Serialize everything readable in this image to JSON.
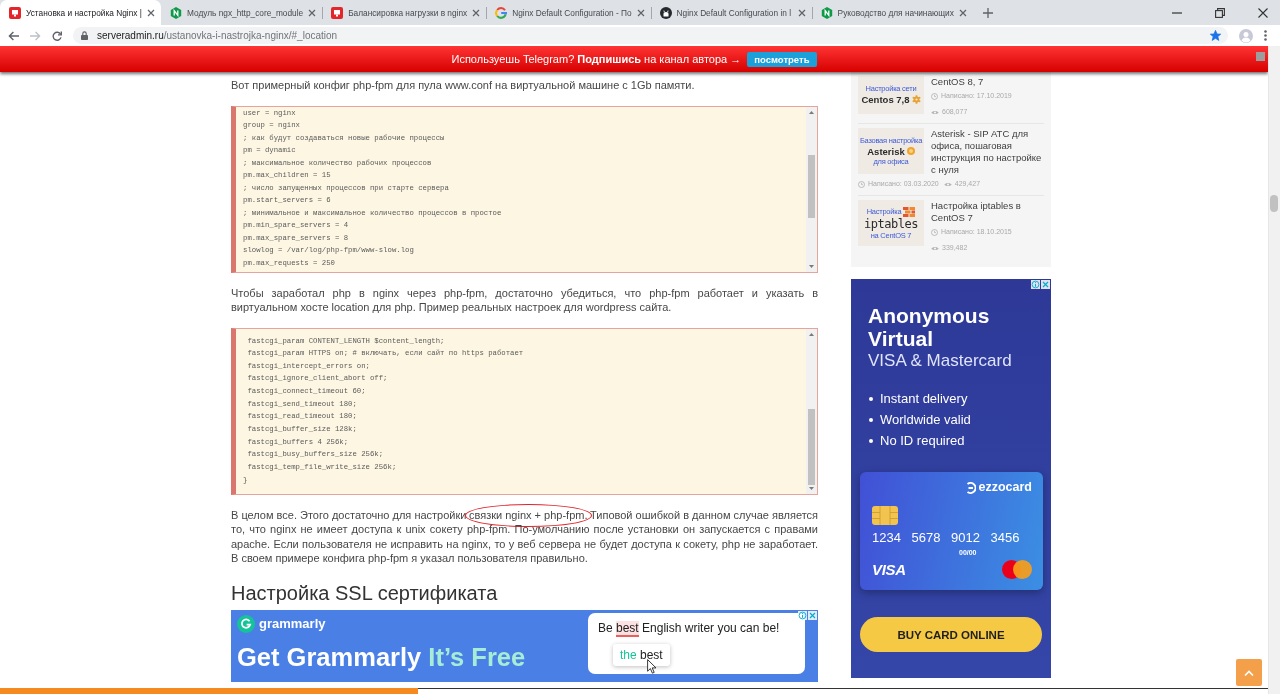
{
  "browser": {
    "tabs": [
      {
        "title": "Установка и настройка Nginx |",
        "kind": "square",
        "selected": true
      },
      {
        "title": "Модуль ngx_http_core_module",
        "kind": "hexagon",
        "selected": false
      },
      {
        "title": "Балансировка нагрузки в nginx",
        "kind": "square",
        "selected": false
      },
      {
        "title": "Nginx Default Configuration - По",
        "kind": "ring",
        "selected": false
      },
      {
        "title": "Nginx Default Configuration in l",
        "kind": "disc",
        "selected": false
      },
      {
        "title": "Руководство для начинающих",
        "kind": "hexagon",
        "selected": false
      }
    ],
    "back_disabled": false,
    "forward_disabled": true,
    "address": {
      "host": "serveradmin.ru",
      "path": "/ustanovka-i-nastrojka-nginx/#_location",
      "bookmarked": true
    }
  },
  "banner": {
    "text": "Используешь Telegram? **Подпишись** на канал автора →",
    "button": "посмотреть"
  },
  "article": {
    "blocks": [
      {
        "kind": "paragraph",
        "text": "Вот примерный конфиг php-fpm для пула www.conf на виртуальной машине с 1Gb памяти."
      },
      {
        "kind": "code",
        "lines": [
          "user = nginx",
          "group = nginx",
          "; как будут создаваться новые рабочие процессы",
          "pm = dynamic",
          "; максимальное количество рабочих процессов",
          "pm.max_children = 15",
          "; число запущенных процессов при старте сервера",
          "pm.start_servers = 6",
          "; минимальное и максимальное количество процессов в простое",
          "pm.min_spare_servers = 4",
          "pm.max_spare_servers = 8",
          "slowlog = /var/log/php-fpm/www-slow.log",
          "pm.max_requests = 250"
        ]
      },
      {
        "kind": "paragraph",
        "text": "Чтобы заработал php в nginx через php-fpm, достаточно убедиться, что php-fpm работает и указать в виртуальном хосте location для php. Пример реальных настроек для wordpress сайта."
      },
      {
        "kind": "code",
        "lines": [
          " fastcgi_param CONTENT_LENGTH $content_length;",
          " fastcgi_param HTTPS on; # включать, если сайт по https работает",
          " fastcgi_intercept_errors on;",
          " fastcgi_ignore_client_abort off;",
          " fastcgi_connect_timeout 60;",
          " fastcgi_send_timeout 180;",
          " fastcgi_read_timeout 180;",
          " fastcgi_buffer_size 128k;",
          " fastcgi_buffers 4 256k;",
          " fastcgi_busy_buffers_size 256k;",
          " fastcgi_temp_file_write_size 256k;",
          "}"
        ]
      },
      {
        "kind": "paragraph",
        "segments": [
          {
            "text": "В целом все. Этого достаточно для настройки ",
            "circled": false
          },
          {
            "text": "связки nginx + php-fpm.",
            "circled": true
          },
          {
            "text": " Типовой ошибкой в данном случае является то, что nginx не имеет доступа к unix сокету php-fpm. По-умолчанию после установки он запускается с правами apache. Если пользователя не исправить на nginx, то у веб сервера не будет доступа к сокету, php не заработает. В своем примере конфига php-fpm я указал пользователя правильно.",
            "circled": false
          }
        ]
      },
      {
        "kind": "heading",
        "text": "Настройка SSL сертификата"
      },
      {
        "kind": "ad",
        "brand": "grammarly",
        "headline": [
          {
            "text": "Get Grammarly ",
            "accent": false
          },
          {
            "text": "It’s Free",
            "accent": true
          }
        ],
        "sentence": [
          {
            "text": "Be ",
            "highlighted": false
          },
          {
            "text": "best",
            "highlighted": true
          },
          {
            "text": " English writer you can be!",
            "highlighted": false
          }
        ],
        "suggestion": [
          {
            "text": "the ",
            "inserted": true
          },
          {
            "text": "best",
            "inserted": false
          }
        ]
      }
    ]
  },
  "sidebar": {
    "posts": [
      {
        "thumbnail": [
          {
            "text": "Настройка сети",
            "kind": "caption"
          },
          {
            "text": "Centos 7,8",
            "kind": "title"
          }
        ],
        "title": "CentOS 8, 7",
        "date": "Написано: 17.10.2019",
        "views": "608,077"
      },
      {
        "thumbnail": [
          {
            "text": "Базовая настройка",
            "kind": "caption"
          },
          {
            "text": "Asterisk",
            "kind": "title"
          },
          {
            "text": "для офиса",
            "kind": "caption"
          }
        ],
        "title": "Asterisk - SIP АТС для офиса, пошаговая инструкция по настройке с нуля",
        "date": "Написано: 03.03.2020",
        "views": "429,427"
      },
      {
        "thumbnail": [
          {
            "text": "Настройка",
            "kind": "caption"
          },
          {
            "text": "iptables",
            "kind": "large"
          },
          {
            "text": "на CentOS 7",
            "kind": "caption"
          }
        ],
        "title": "Настройка iptables в CentOS 7",
        "date": "Написано: 18.10.2015",
        "views": "339,482"
      }
    ],
    "ad": {
      "headline": "Anonymous Virtual",
      "subheadline": "VISA & Mastercard",
      "features": [
        "Instant delivery",
        "Worldwide valid",
        "No ID required"
      ],
      "card": {
        "brand": "ezzocard",
        "number": "1234 5678 9012 3456",
        "expiry": "00/00",
        "network": "VISA"
      },
      "button": "BUY CARD ONLINE"
    }
  },
  "reading_progress": {
    "level": 0.33
  }
}
